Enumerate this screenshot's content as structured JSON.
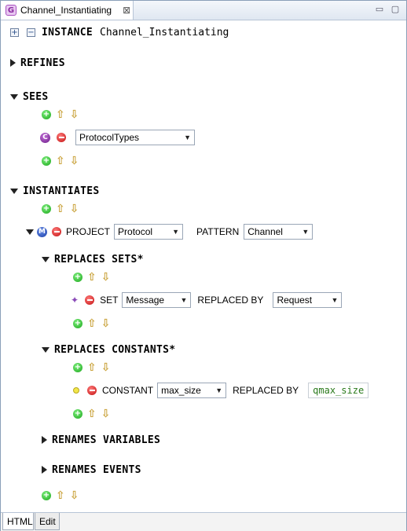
{
  "tab": {
    "title": "Channel_Instantiating",
    "close": "⊠"
  },
  "header": {
    "keyword": "INSTANCE",
    "name": "Channel_Instantiating"
  },
  "sections": {
    "refines": "REFINES",
    "sees": "SEES",
    "instantiates": "INSTANTIATES",
    "replaces_sets": "REPLACES SETS*",
    "replaces_constants": "REPLACES CONSTANTS*",
    "renames_variables": "RENAMES VARIABLES",
    "renames_events": "RENAMES EVENTS"
  },
  "sees_item": {
    "context": "ProtocolTypes"
  },
  "instantiate_item": {
    "project_label": "PROJECT",
    "project_value": "Protocol",
    "pattern_label": "PATTERN",
    "pattern_value": "Channel"
  },
  "set_item": {
    "label": "SET",
    "value": "Message",
    "replaced_by_label": "REPLACED BY",
    "replaced_by_value": "Request"
  },
  "constant_item": {
    "label": "CONSTANT",
    "value": "max_size",
    "replaced_by_label": "REPLACED BY",
    "replaced_by_value": "qmax_size"
  },
  "icons": {
    "c_badge": "C",
    "m_badge": "M",
    "tab_icon": "G"
  },
  "bottom_tabs": {
    "html": "HTML",
    "edit": "Edit"
  }
}
